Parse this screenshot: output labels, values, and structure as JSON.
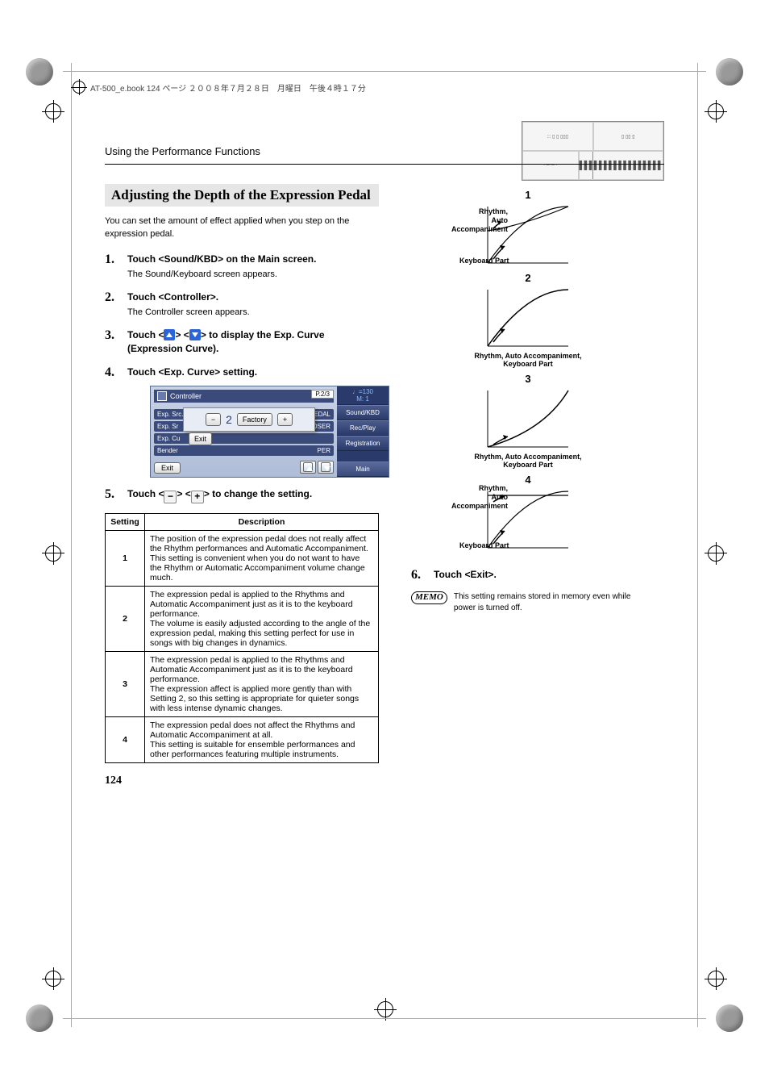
{
  "header_text": "AT-500_e.book  124 ページ  ２００８年７月２８日　月曜日　午後４時１７分",
  "running_head": "Using the Performance Functions",
  "section_title": "Adjusting the Depth of the Expression Pedal",
  "intro": "You can set the amount of effect applied when you step on the expression pedal.",
  "steps": {
    "s1_head": "Touch <Sound/KBD> on the Main screen.",
    "s1_sub": "The Sound/Keyboard screen appears.",
    "s2_head": "Touch <Controller>.",
    "s2_sub": "The Controller screen appears.",
    "s3_head_a": "Touch <",
    "s3_head_b": "> <",
    "s3_head_c": "> to display the Exp. Curve (Expression Curve).",
    "s4_head": "Touch <Exp. Curve> setting.",
    "s5_head_a": "Touch <",
    "s5_head_b": "> <",
    "s5_head_c": "> to change the setting.",
    "s6_head": "Touch <Exit>."
  },
  "screenshot": {
    "title": "Controller",
    "page": "P.2/3",
    "tempo": "♩=130",
    "measure": "M:   1",
    "side": {
      "a": "Sound/KBD",
      "b": "Rec/Play",
      "c": "Registration",
      "d": "Main"
    },
    "rows": {
      "a": "Exp. Src. (Rec)",
      "a_val": "PEDAL",
      "b": "Exp. Sr",
      "b_val": "MPOSER",
      "c": "Exp. Cu",
      "d": "Bender",
      "d_val": "PER"
    },
    "popup": {
      "minus": "−",
      "val": "2",
      "factory": "Factory",
      "plus": "+",
      "exit": "Exit"
    },
    "exit": "Exit"
  },
  "table": {
    "h1": "Setting",
    "h2": "Description",
    "r1n": "1",
    "r1d": "The position of the expression pedal does not really affect the Rhythm performances and Automatic Accompaniment.\nThis setting is convenient when you do not want to have the Rhythm or Automatic Accompaniment volume change much.",
    "r2n": "2",
    "r2d": "The expression pedal is applied to the Rhythms and Automatic Accompaniment just as it is to the keyboard performance.\nThe volume is easily adjusted according to the angle of the expression pedal, making this setting perfect for use in songs with big changes in dynamics.",
    "r3n": "3",
    "r3d": "The expression pedal is applied to the Rhythms and Automatic Accompaniment just as it is to the keyboard performance.\nThe expression affect is applied more gently than with Setting 2, so this setting is appropriate for quieter songs with less intense dynamic changes.",
    "r4n": "4",
    "r4d": "The expression pedal does not affect the Rhythms and Automatic Accompaniment at all.\nThis setting is suitable for ensemble performances and other performances featuring multiple instruments."
  },
  "curves": {
    "lbl_rhythm": "Rhythm,\nAuto\nAccompaniment",
    "lbl_kbd": "Keyboard Part",
    "cap_both": "Rhythm, Auto Accompaniment, Keyboard Part",
    "n1": "1",
    "n2": "2",
    "n3": "3",
    "n4": "4"
  },
  "memo": {
    "badge": "MEMO",
    "text": "This setting remains stored in memory even while power is turned off."
  },
  "page_number": "124"
}
